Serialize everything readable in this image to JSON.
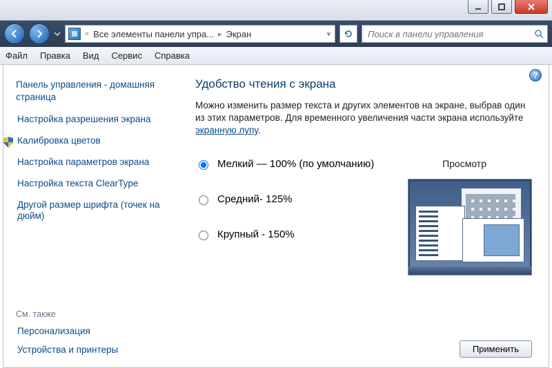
{
  "titlebar": {
    "minimize": "minimize",
    "maximize": "maximize",
    "close": "close"
  },
  "nav": {
    "back": "back",
    "forward": "forward",
    "breadcrumb_prefix": "«",
    "breadcrumb_1": "Все элементы панели упра...",
    "breadcrumb_2": "Экран",
    "search_placeholder": "Поиск в панели управления"
  },
  "menu": {
    "file": "Файл",
    "edit": "Правка",
    "view": "Вид",
    "service": "Сервис",
    "help": "Справка"
  },
  "sidebar": {
    "home": "Панель управления - домашняя страница",
    "links": [
      "Настройка разрешения экрана",
      "Калибровка цветов",
      "Настройка параметров экрана",
      "Настройка текста ClearType",
      "Другой размер шрифта (точек на дюйм)"
    ],
    "see_also_label": "См. также",
    "see_also": [
      "Персонализация",
      "Устройства и принтеры"
    ]
  },
  "content": {
    "heading": "Удобство чтения с экрана",
    "desc1": "Можно изменить размер текста и других элементов на экране, выбрав один из этих параметров. Для временного увеличения части экрана используйте ",
    "magnifier_link": "экранную лупу",
    "desc_end": ".",
    "options": [
      {
        "label": "Мелкий — 100% (по умолчанию)",
        "selected": true
      },
      {
        "label": "Средний- 125%",
        "selected": false
      },
      {
        "label": "Крупный - 150%",
        "selected": false
      }
    ],
    "preview_label": "Просмотр",
    "apply": "Применить"
  },
  "help": "?"
}
